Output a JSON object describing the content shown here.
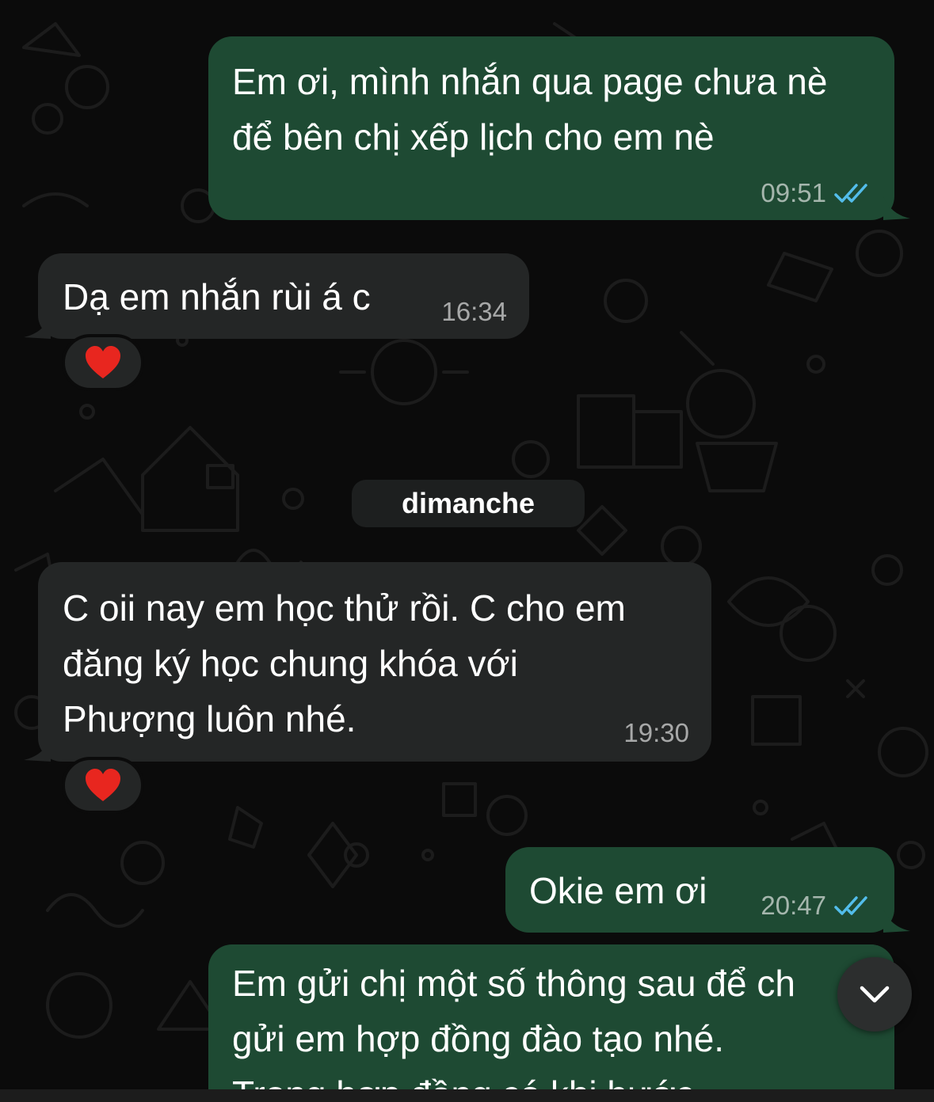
{
  "messages": [
    {
      "direction": "out",
      "text": "Em ơi, mình nhắn qua page chưa nè\nđể bên chị xếp lịch cho em nè",
      "time": "09:51",
      "status": "read"
    },
    {
      "direction": "in",
      "text": "Dạ em nhắn rùi á c",
      "time": "16:34",
      "reaction": "❤️"
    },
    {
      "direction": "in",
      "text": "C oii nay em học thử rồi. C cho em\nđăng ký học chung khóa với\nPhượng luôn nhé.",
      "time": "19:30",
      "reaction": "❤️"
    },
    {
      "direction": "out",
      "text": "Okie em ơi",
      "time": "20:47",
      "status": "read"
    },
    {
      "direction": "out",
      "text": "Em gửi chị một số thông sau để ch\ngửi em hợp đồng đào tạo nhé.\nTrong hợp đồng có khi bước",
      "status": "partially-visible"
    }
  ],
  "date_separator": "dimanche",
  "scroll_button_icon": "chevron-down-icon",
  "colors": {
    "background": "#0b0b0b",
    "outgoing_bubble": "#1e4a33",
    "incoming_bubble": "#242626",
    "read_ticks": "#53bdeb",
    "timestamp": "#9aa0a0"
  }
}
